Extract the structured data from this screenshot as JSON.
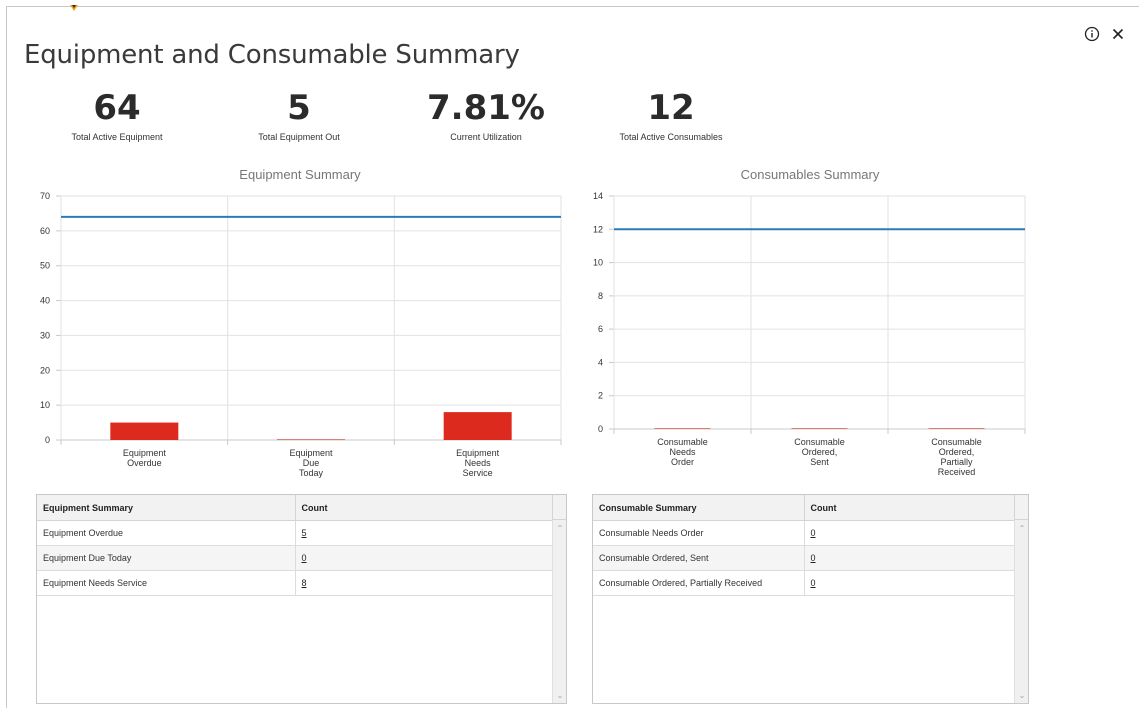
{
  "page": {
    "title": "Equipment and Consumable Summary",
    "info_icon": "info-circle-icon",
    "close_icon": "close-icon"
  },
  "kpis": [
    {
      "value": "64",
      "label": "Total Active Equipment"
    },
    {
      "value": "5",
      "label": "Total Equipment Out"
    },
    {
      "value": "7.81%",
      "label": "Current Utilization"
    },
    {
      "value": "12",
      "label": "Total Active Consumables"
    }
  ],
  "colors": {
    "bar": "#dc2a1e",
    "line": "#2b7bb9",
    "grid": "#e2e2e2",
    "axis": "#c8c8c8"
  },
  "chart_data": [
    {
      "type": "bar",
      "title": "Equipment Summary",
      "categories": [
        [
          "Equipment",
          "Overdue"
        ],
        [
          "Equipment",
          "Due",
          "Today"
        ],
        [
          "Equipment",
          "Needs",
          "Service"
        ]
      ],
      "values": [
        5,
        0,
        8
      ],
      "ylim": [
        0,
        70
      ],
      "yticks": [
        "0",
        "10",
        "20",
        "30",
        "40",
        "50",
        "60",
        "70"
      ],
      "reference_line": 64,
      "grid": true
    },
    {
      "type": "bar",
      "title": "Consumables Summary",
      "categories": [
        [
          "Consumable",
          "Needs",
          "Order"
        ],
        [
          "Consumable",
          "Ordered,",
          "Sent"
        ],
        [
          "Consumable",
          "Ordered,",
          "Partially",
          "Received"
        ]
      ],
      "values": [
        0,
        0,
        0
      ],
      "ylim": [
        0,
        14
      ],
      "yticks": [
        "0",
        "2",
        "4",
        "6",
        "8",
        "10",
        "12",
        "14"
      ],
      "reference_line": 12,
      "grid": true
    }
  ],
  "equipment_table": {
    "headers": [
      "Equipment Summary",
      "Count"
    ],
    "rows": [
      {
        "name": "Equipment Overdue",
        "count": "5"
      },
      {
        "name": "Equipment Due Today",
        "count": "0"
      },
      {
        "name": "Equipment Needs Service",
        "count": "8"
      }
    ]
  },
  "consumable_table": {
    "headers": [
      "Consumable Summary",
      "Count"
    ],
    "rows": [
      {
        "name": "Consumable Needs Order",
        "count": "0"
      },
      {
        "name": "Consumable Ordered, Sent",
        "count": "0"
      },
      {
        "name": "Consumable Ordered, Partially Received",
        "count": "0"
      }
    ]
  }
}
